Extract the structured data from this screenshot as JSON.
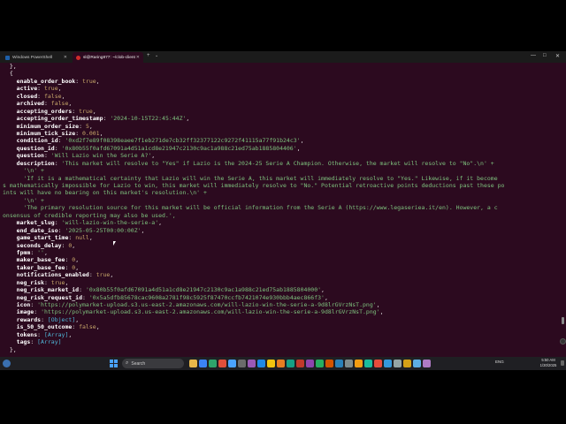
{
  "tabs": [
    {
      "label": "Windows PowerShell",
      "icon": "powershell-icon"
    },
    {
      "label": "sl@Raring877: ~/clob-client",
      "icon": "ubuntu-icon"
    }
  ],
  "new_tab_label": "+",
  "dropdown_label": "⌄",
  "window_controls": [
    "—",
    "□",
    "✕"
  ],
  "terminal": {
    "lines": [
      [
        [
          "  },",
          "w"
        ]
      ],
      [
        [
          "  {",
          "w"
        ]
      ],
      [
        [
          "    ",
          "w"
        ],
        [
          "enable_order_book",
          "k"
        ],
        [
          ": ",
          "w"
        ],
        [
          "true",
          "b"
        ],
        [
          ",",
          "w"
        ]
      ],
      [
        [
          "    ",
          "w"
        ],
        [
          "active",
          "k"
        ],
        [
          ": ",
          "w"
        ],
        [
          "true",
          "b"
        ],
        [
          ",",
          "w"
        ]
      ],
      [
        [
          "    ",
          "w"
        ],
        [
          "closed",
          "k"
        ],
        [
          ": ",
          "w"
        ],
        [
          "false",
          "b"
        ],
        [
          ",",
          "w"
        ]
      ],
      [
        [
          "    ",
          "w"
        ],
        [
          "archived",
          "k"
        ],
        [
          ": ",
          "w"
        ],
        [
          "false",
          "b"
        ],
        [
          ",",
          "w"
        ]
      ],
      [
        [
          "    ",
          "w"
        ],
        [
          "accepting_orders",
          "k"
        ],
        [
          ": ",
          "w"
        ],
        [
          "true",
          "b"
        ],
        [
          ",",
          "w"
        ]
      ],
      [
        [
          "    ",
          "w"
        ],
        [
          "accepting_order_timestamp",
          "k"
        ],
        [
          ": ",
          "w"
        ],
        [
          "'2024-10-15T22:45:44Z'",
          "s"
        ],
        [
          ",",
          "w"
        ]
      ],
      [
        [
          "    ",
          "w"
        ],
        [
          "minimum_order_size",
          "k"
        ],
        [
          ": ",
          "w"
        ],
        [
          "5",
          "n"
        ],
        [
          ",",
          "w"
        ]
      ],
      [
        [
          "    ",
          "w"
        ],
        [
          "minimum_tick_size",
          "k"
        ],
        [
          ": ",
          "w"
        ],
        [
          "0.001",
          "n"
        ],
        [
          ",",
          "w"
        ]
      ],
      [
        [
          "    ",
          "w"
        ],
        [
          "condition_id",
          "k"
        ],
        [
          ": ",
          "w"
        ],
        [
          "'0xd2f7e89f08398eaee7f1eb271de7cb32ff32377122c9272f41115a77f91b24c3'",
          "s"
        ],
        [
          ",",
          "w"
        ]
      ],
      [
        [
          "    ",
          "w"
        ],
        [
          "question_id",
          "k"
        ],
        [
          ": ",
          "w"
        ],
        [
          "'0x80b55f0afd67091a4d51a1cd8e21947c2130c9ac1a988c21ed75ab1885804406'",
          "s"
        ],
        [
          ",",
          "w"
        ]
      ],
      [
        [
          "    ",
          "w"
        ],
        [
          "question",
          "k"
        ],
        [
          ": ",
          "w"
        ],
        [
          "'Will Lazio win the Serie A?'",
          "s"
        ],
        [
          ",",
          "w"
        ]
      ],
      [
        [
          "    ",
          "w"
        ],
        [
          "description",
          "k"
        ],
        [
          ": ",
          "w"
        ],
        [
          "'This market will resolve to \"Yes\" if Lazio is the 2024-25 Serie A Champion. Otherwise, the market will resolve to \"No\".\\n' +",
          "s"
        ]
      ],
      [
        [
          "      ",
          "w"
        ],
        [
          "'\\n' +",
          "s"
        ]
      ],
      [
        [
          "      ",
          "w"
        ],
        [
          "'If it is a mathematical certainty that Lazio will win the Serie A, this market will immediately resolve to \"Yes.\" Likewise, if it become",
          "s"
        ]
      ],
      [
        [
          "s mathematically impossible for Lazio to win, this market will immediately resolve to \"No.\" Potential retroactive points deductions past these po",
          "s"
        ]
      ],
      [
        [
          "ints will have no bearing on this market's resolution.\\n' +",
          "s"
        ]
      ],
      [
        [
          "      ",
          "w"
        ],
        [
          "'\\n' +",
          "s"
        ]
      ],
      [
        [
          "      ",
          "w"
        ],
        [
          "'The primary resolution source for this market will be official information from the Serie A (https://www.legaseriea.it/en). However, a c",
          "s"
        ]
      ],
      [
        [
          "onsensus of credible reporting may also be used.',",
          "s"
        ]
      ],
      [
        [
          "    ",
          "w"
        ],
        [
          "market_slug",
          "k"
        ],
        [
          ": ",
          "w"
        ],
        [
          "'will-lazio-win-the-serie-a'",
          "s"
        ],
        [
          ",",
          "w"
        ]
      ],
      [
        [
          "    ",
          "w"
        ],
        [
          "end_date_iso",
          "k"
        ],
        [
          ": ",
          "w"
        ],
        [
          "'2025-05-25T00:00:00Z'",
          "s"
        ],
        [
          ",",
          "w"
        ]
      ],
      [
        [
          "    ",
          "w"
        ],
        [
          "game_start_time",
          "k"
        ],
        [
          ": ",
          "w"
        ],
        [
          "null",
          "b"
        ],
        [
          ",",
          "w"
        ]
      ],
      [
        [
          "    ",
          "w"
        ],
        [
          "seconds_delay",
          "k"
        ],
        [
          ": ",
          "w"
        ],
        [
          "0",
          "n"
        ],
        [
          ",",
          "w"
        ]
      ],
      [
        [
          "    ",
          "w"
        ],
        [
          "fpmm",
          "k"
        ],
        [
          ": ",
          "w"
        ],
        [
          "''",
          "s"
        ],
        [
          ",",
          "w"
        ]
      ],
      [
        [
          "    ",
          "w"
        ],
        [
          "maker_base_fee",
          "k"
        ],
        [
          ": ",
          "w"
        ],
        [
          "0",
          "n"
        ],
        [
          ",",
          "w"
        ]
      ],
      [
        [
          "    ",
          "w"
        ],
        [
          "taker_base_fee",
          "k"
        ],
        [
          ": ",
          "w"
        ],
        [
          "0",
          "n"
        ],
        [
          ",",
          "w"
        ]
      ],
      [
        [
          "    ",
          "w"
        ],
        [
          "notifications_enabled",
          "k"
        ],
        [
          ": ",
          "w"
        ],
        [
          "true",
          "b"
        ],
        [
          ",",
          "w"
        ]
      ],
      [
        [
          "    ",
          "w"
        ],
        [
          "neg_risk",
          "k"
        ],
        [
          ": ",
          "w"
        ],
        [
          "true",
          "b"
        ],
        [
          ",",
          "w"
        ]
      ],
      [
        [
          "    ",
          "w"
        ],
        [
          "neg_risk_market_id",
          "k"
        ],
        [
          ": ",
          "w"
        ],
        [
          "'0x80b55f0afd67091a4d51a1cd8e21947c2130c9ac1a988c21ed75ab1885804000'",
          "s"
        ],
        [
          ",",
          "w"
        ]
      ],
      [
        [
          "    ",
          "w"
        ],
        [
          "neg_risk_request_id",
          "k"
        ],
        [
          ": ",
          "w"
        ],
        [
          "'0x5a5dfb85678cac9608a2781f98c5925f87470ccfb7421074e930bbb4aec866f3'",
          "s"
        ],
        [
          ",",
          "w"
        ]
      ],
      [
        [
          "    ",
          "w"
        ],
        [
          "icon",
          "k"
        ],
        [
          ": ",
          "w"
        ],
        [
          "'https://polymarket-upload.s3.us-east-2.amazonaws.com/will-lazio-win-the-serie-a-9d8lrGVrzNsT.png'",
          "s"
        ],
        [
          ",",
          "w"
        ]
      ],
      [
        [
          "    ",
          "w"
        ],
        [
          "image",
          "k"
        ],
        [
          ": ",
          "w"
        ],
        [
          "'https://polymarket-upload.s3.us-east-2.amazonaws.com/will-lazio-win-the-serie-a-9d8lrGVrzNsT.png'",
          "s"
        ],
        [
          ",",
          "w"
        ]
      ],
      [
        [
          "    ",
          "w"
        ],
        [
          "rewards",
          "k"
        ],
        [
          ": ",
          "w"
        ],
        [
          "[Object]",
          "c"
        ],
        [
          ",",
          "w"
        ]
      ],
      [
        [
          "    ",
          "w"
        ],
        [
          "is_50_50_outcome",
          "k"
        ],
        [
          ": ",
          "w"
        ],
        [
          "false",
          "b"
        ],
        [
          ",",
          "w"
        ]
      ],
      [
        [
          "    ",
          "w"
        ],
        [
          "tokens",
          "k"
        ],
        [
          ": ",
          "w"
        ],
        [
          "[Array]",
          "c"
        ],
        [
          ",",
          "w"
        ]
      ],
      [
        [
          "    ",
          "w"
        ],
        [
          "tags",
          "k"
        ],
        [
          ": ",
          "w"
        ],
        [
          "[Array]",
          "c"
        ]
      ],
      [
        [
          "  },",
          "w"
        ]
      ]
    ]
  },
  "taskbar": {
    "search_label": "Search",
    "tray_lang": "ENG",
    "clock_time": "5:50 AM",
    "clock_date": "1/30/2025",
    "pinned_icons": [
      "file-explorer-icon",
      "store-icon",
      "edge-icon",
      "chrome-icon",
      "mail-icon",
      "terminal-icon",
      "settings-icon",
      "vscode-icon",
      "app-icon",
      "app-icon",
      "app-icon",
      "app-icon",
      "app-icon",
      "app-icon",
      "app-icon",
      "app-icon",
      "app-icon",
      "app-icon",
      "app-icon",
      "app-icon",
      "app-icon",
      "app-icon",
      "app-icon",
      "app-icon",
      "app-icon"
    ]
  },
  "colors": {
    "terminal_bg": "#2c0a1f",
    "string": "#7ec27e",
    "number": "#c9a86a",
    "key": "#ffffff",
    "object_ref": "#4fb7d8",
    "taskbar_bg": "#1f1f23"
  }
}
